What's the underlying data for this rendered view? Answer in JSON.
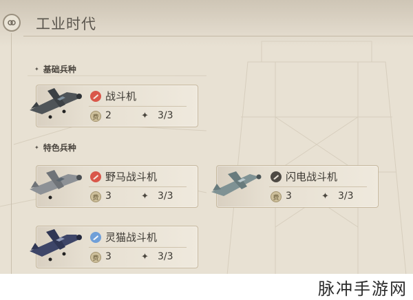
{
  "header": {
    "title": "工业时代",
    "back_icon": "link-icon"
  },
  "sections": [
    {
      "label": "基础兵种"
    },
    {
      "label": "特色兵种"
    }
  ],
  "units": [
    {
      "name": "战斗机",
      "badge": "red",
      "cost": "2",
      "count": "3/3"
    },
    {
      "name": "野马战斗机",
      "badge": "red",
      "cost": "3",
      "count": "3/3"
    },
    {
      "name": "闪电战斗机",
      "badge": "dark",
      "cost": "3",
      "count": "3/3"
    },
    {
      "name": "灵猫战斗机",
      "badge": "blue",
      "cost": "3",
      "count": "3/3"
    }
  ],
  "icons": {
    "cost": "coin-icon",
    "count": "sparkle-icon"
  },
  "colors": {
    "badge_red": "#d9574a",
    "badge_dark": "#4e4a44",
    "badge_blue": "#6f9fd8"
  },
  "cost_glyph": "费",
  "count_glyph": "✦",
  "watermark": "脉冲手游网"
}
